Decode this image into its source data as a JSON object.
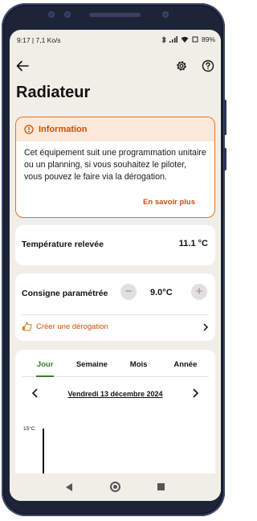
{
  "status": {
    "time_speed": "9:17 | 7,1 Ko/s",
    "battery": "89%"
  },
  "header": {
    "title": "Radiateur"
  },
  "info": {
    "title": "Information",
    "text": "Cet équipement suit une programmation unitaire ou un planning, si vous souhaitez le piloter, vous pouvez le faire via la dérogation.",
    "link": "En savoir plus"
  },
  "temperature": {
    "label": "Température relevée",
    "value": "11.1 °C"
  },
  "setpoint": {
    "label": "Consigne paramétrée",
    "value": "9.0°C",
    "minus": "−",
    "plus": "+",
    "derogation_label": "Créer une dérogation"
  },
  "history": {
    "tabs": [
      "Jour",
      "Semaine",
      "Mois",
      "Année"
    ],
    "active_tab": "Jour",
    "date": "Vendredi 13 décembre 2024",
    "y_tick": "15°C"
  },
  "colors": {
    "accent": "#e3731f",
    "accent_dark": "#c4510f",
    "tab_active": "#3a7a2c",
    "background": "#f1eee7"
  },
  "icons": {
    "back": "arrow-left-icon",
    "settings": "gear-icon",
    "help": "question-icon",
    "info": "info-circle-icon",
    "derogation": "hand-icon",
    "chevron": "chevron-right-icon"
  }
}
